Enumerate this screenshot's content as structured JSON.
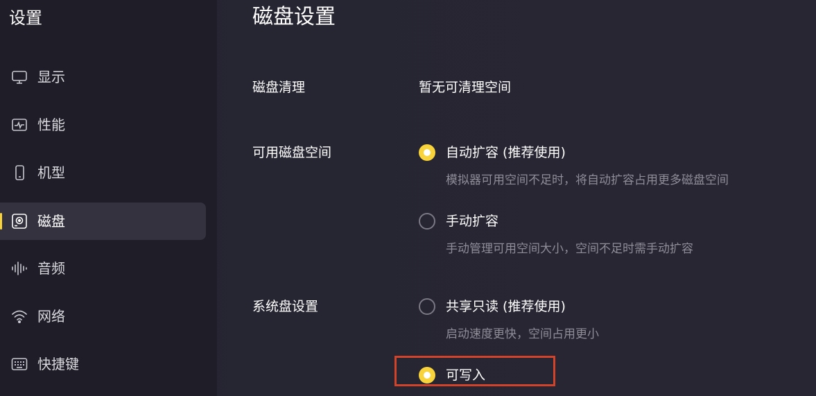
{
  "sidebar": {
    "title": "设置",
    "items": [
      {
        "label": "显示",
        "icon": "monitor-icon"
      },
      {
        "label": "性能",
        "icon": "performance-icon"
      },
      {
        "label": "机型",
        "icon": "phone-icon"
      },
      {
        "label": "磁盘",
        "icon": "disk-icon",
        "active": true
      },
      {
        "label": "音频",
        "icon": "audio-icon"
      },
      {
        "label": "网络",
        "icon": "wifi-icon"
      },
      {
        "label": "快捷键",
        "icon": "keyboard-icon"
      }
    ]
  },
  "main": {
    "title": "磁盘设置",
    "disk_cleanup": {
      "label": "磁盘清理",
      "value": "暂无可清理空间"
    },
    "available_space": {
      "label": "可用磁盘空间",
      "options": [
        {
          "label": "自动扩容 (推荐使用)",
          "desc": "模拟器可用空间不足时，将自动扩容占用更多磁盘空间",
          "checked": true
        },
        {
          "label": "手动扩容",
          "desc": "手动管理可用空间大小，空间不足时需手动扩容",
          "checked": false
        }
      ]
    },
    "system_disk": {
      "label": "系统盘设置",
      "options": [
        {
          "label": "共享只读 (推荐使用)",
          "desc": "启动速度更快，空间占用更小",
          "checked": false
        },
        {
          "label": "可写入",
          "checked": true
        }
      ]
    }
  },
  "colors": {
    "accent": "#f9d33b",
    "highlight": "#d2432a",
    "background": "#24232e",
    "sidebar_bg": "#1f1e28"
  }
}
